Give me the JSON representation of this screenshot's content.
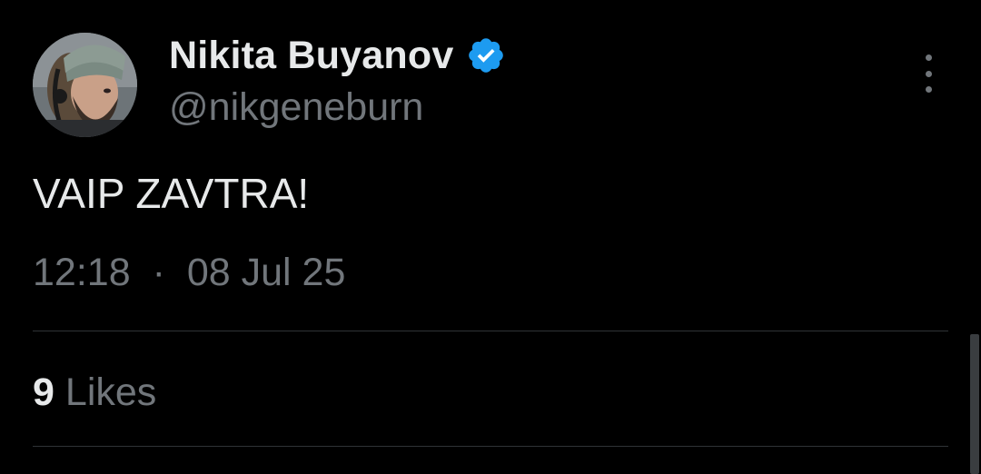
{
  "author": {
    "display_name": "Nikita Buyanov",
    "handle": "@nikgeneburn",
    "verified": true,
    "verified_color": "#1d9bf0"
  },
  "tweet": {
    "text": "VAIP ZAVTRA!",
    "time": "12:18",
    "separator": "·",
    "date": "08 Jul 25"
  },
  "stats": {
    "likes_count": "9",
    "likes_label": "Likes"
  },
  "icons": {
    "more": "more-vertical-icon",
    "verified": "verified-badge-icon"
  },
  "colors": {
    "background": "#000000",
    "primary_text": "#e7e9ea",
    "secondary_text": "#71767b",
    "divider": "#2f3336"
  }
}
